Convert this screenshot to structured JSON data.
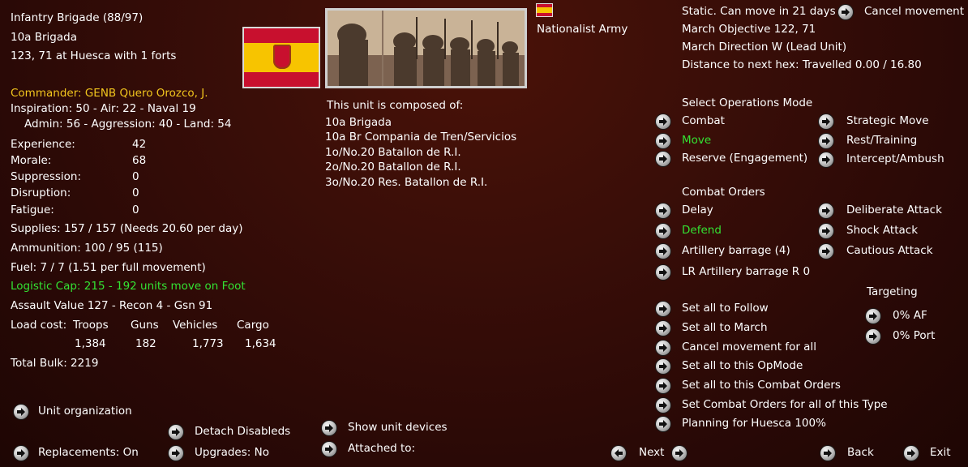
{
  "unit": {
    "name": "Infantry Brigade (88/97)",
    "designation": "10a Brigada",
    "location": "123, 71 at Huesca with 1 forts",
    "army": "Nationalist Army"
  },
  "commander": {
    "label": "Commander: GENB Quero Orozco, J.",
    "line1": "Inspiration: 50 - Air: 22 - Naval 19",
    "line2": "Admin: 56 - Aggression: 40 - Land: 54"
  },
  "stats": [
    {
      "label": "Experience:",
      "value": "42"
    },
    {
      "label": "Morale:",
      "value": "68"
    },
    {
      "label": "Suppression:",
      "value": "0"
    },
    {
      "label": "Disruption:",
      "value": "0"
    },
    {
      "label": "Fatigue:",
      "value": "0"
    }
  ],
  "supplies": "Supplies: 157 / 157 (Needs 20.60 per day)",
  "ammunition": "Ammunition: 100 / 95 (115)",
  "fuel": "Fuel: 7 / 7 (1.51 per full movement)",
  "logistic": "Logistic Cap: 215 - 192 units move on Foot",
  "assault": "Assault Value 127 - Recon 4  - Gsn 91",
  "load": {
    "label": "Load cost:",
    "headers": [
      "Troops",
      "Guns",
      "Vehicles",
      "Cargo"
    ],
    "values": [
      "1,384",
      "182",
      "1,773",
      "1,634"
    ]
  },
  "total_bulk": "Total Bulk: 2219",
  "bottom_left": {
    "unit_org": "Unit organization",
    "detach": "Detach Disableds",
    "replacements": "Replacements: On",
    "upgrades": "Upgrades: No",
    "show_devices": "Show unit devices",
    "attached": "Attached to:"
  },
  "composition": {
    "title": "This unit is composed of:",
    "items": [
      "10a Brigada",
      "10a Br Compania de Tren/Servicios",
      "1o/No.20 Batallon de R.I.",
      "2o/No.20 Batallon de R.I.",
      "3o/No.20 Res. Batallon de R.I."
    ]
  },
  "movement": {
    "status": "Static. Can move in 21 days",
    "cancel": "Cancel movement",
    "objective": "March Objective 122, 71",
    "direction": "March Direction W (Lead Unit)",
    "distance": "Distance to next hex: Travelled 0.00 / 16.80"
  },
  "ops_mode": {
    "title": "Select Operations Mode",
    "left": [
      "Combat",
      "Move",
      "Reserve (Engagement)"
    ],
    "right": [
      "Strategic Move",
      "Rest/Training",
      "Intercept/Ambush"
    ]
  },
  "combat_orders": {
    "title": "Combat Orders",
    "left": [
      "Delay",
      "Defend",
      "Artillery barrage (4)",
      "LR Artillery barrage R 0"
    ],
    "right": [
      "Deliberate Attack",
      "Shock Attack",
      "Cautious Attack"
    ]
  },
  "targeting": {
    "title": "Targeting",
    "items": [
      "0% AF",
      "0% Port"
    ]
  },
  "set_all": [
    "Set all to Follow",
    "Set all to March",
    "Cancel movement for all",
    "Set all to this OpMode",
    "Set all to this Combat Orders",
    "Set Combat Orders for all of this Type",
    "Planning for Huesca 100%"
  ],
  "nav": {
    "next": "Next",
    "back": "Back",
    "exit": "Exit"
  },
  "colors": {
    "highlight_green": "#33e233",
    "commander_yellow": "#f2c61d",
    "background": "#3a0e08"
  }
}
